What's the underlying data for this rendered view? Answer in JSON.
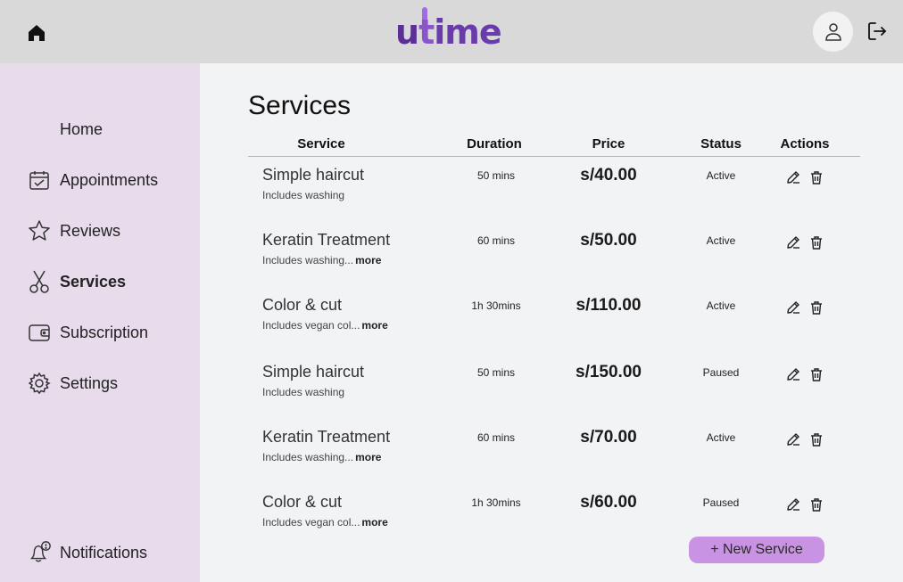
{
  "header": {
    "logo_text": "utime",
    "home_icon": "home-icon",
    "user_icon": "user-icon",
    "logout_icon": "logout-icon"
  },
  "sidebar": {
    "items": [
      {
        "label": "Home",
        "icon": ""
      },
      {
        "label": "Appointments",
        "icon": "calendar-check-icon"
      },
      {
        "label": "Reviews",
        "icon": "star-icon"
      },
      {
        "label": "Services",
        "icon": "scissors-icon",
        "active": true
      },
      {
        "label": "Subscription",
        "icon": "wallet-icon"
      },
      {
        "label": "Settings",
        "icon": "gear-icon"
      }
    ],
    "notifications_label": "Notifications",
    "notifications_icon": "bell-alert-icon"
  },
  "page": {
    "title": "Services"
  },
  "table": {
    "columns": [
      "Service",
      "Duration",
      "Price",
      "Status",
      "Actions"
    ],
    "rows": [
      {
        "name": "Simple haircut",
        "desc": "Includes washing",
        "more": "",
        "duration": "50 mins",
        "price": "s/40.00",
        "status": "Active"
      },
      {
        "name": "Keratin Treatment",
        "desc": "Includes washing...",
        "more": "more",
        "duration": "60 mins",
        "price": "s/50.00",
        "status": "Active"
      },
      {
        "name": "Color & cut",
        "desc": "Includes vegan col...",
        "more": "more",
        "duration": "1h 30mins",
        "price": "s/110.00",
        "status": "Active"
      },
      {
        "name": "Simple haircut",
        "desc": "Includes washing",
        "more": "",
        "duration": "50 mins",
        "price": "s/150.00",
        "status": "Paused"
      },
      {
        "name": "Keratin Treatment",
        "desc": "Includes washing...",
        "more": "more",
        "duration": "60 mins",
        "price": "s/70.00",
        "status": "Active"
      },
      {
        "name": "Color & cut",
        "desc": "Includes vegan col...",
        "more": "more",
        "duration": "1h 30mins",
        "price": "s/60.00",
        "status": "Paused"
      }
    ],
    "edit_icon": "pencil-icon",
    "delete_icon": "trash-icon"
  },
  "actions": {
    "new_service_label": "+ New Service"
  },
  "colors": {
    "topbar": "#d9d9d9",
    "sidebar": "#e8dbec",
    "content_bg": "#f2f3f5",
    "brand_purple": "#5b2f93",
    "button": "#c993e3"
  }
}
